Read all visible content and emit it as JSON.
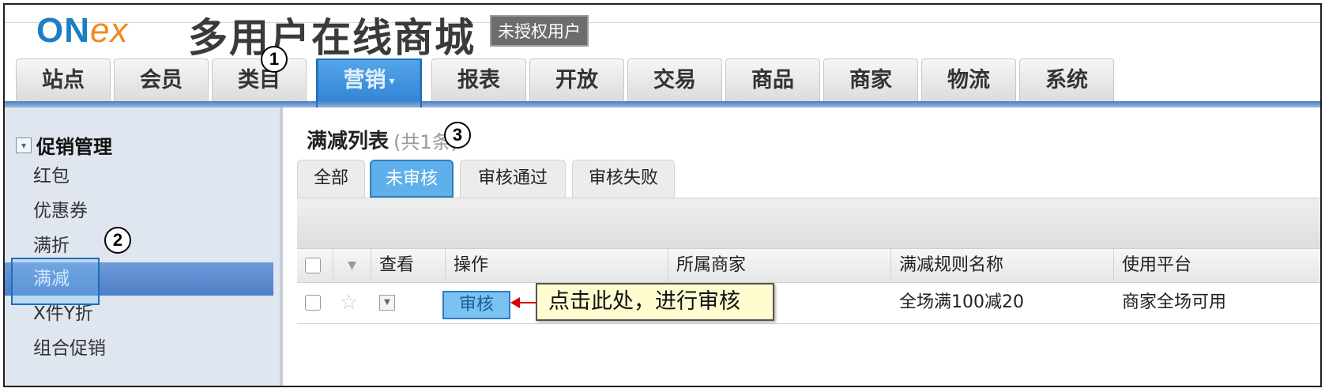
{
  "header": {
    "logo_on": "ON",
    "logo_ex": "ex",
    "title": "多用户在线商城",
    "badge": "未授权用户"
  },
  "nav": {
    "tabs": [
      {
        "label": "站点"
      },
      {
        "label": "会员"
      },
      {
        "label": "类目"
      },
      {
        "label": "营销"
      },
      {
        "label": "报表"
      },
      {
        "label": "开放"
      },
      {
        "label": "交易"
      },
      {
        "label": "商品"
      },
      {
        "label": "商家"
      },
      {
        "label": "物流"
      },
      {
        "label": "系统"
      }
    ],
    "active_index": 3
  },
  "steps": [
    "1",
    "2",
    "3"
  ],
  "sidebar": {
    "group_title": "促销管理",
    "items": [
      {
        "label": "红包"
      },
      {
        "label": "优惠券"
      },
      {
        "label": "满折"
      },
      {
        "label": "满减"
      },
      {
        "label": "X件Y折"
      },
      {
        "label": "组合促销"
      }
    ],
    "active_index": 3
  },
  "main": {
    "title": "满减列表",
    "count": "(共1条)",
    "tabs": [
      {
        "label": "全部"
      },
      {
        "label": "未审核"
      },
      {
        "label": "审核通过"
      },
      {
        "label": "审核失败"
      }
    ],
    "active_tab_index": 1,
    "columns": [
      "查看",
      "操作",
      "所属商家",
      "满减规则名称",
      "使用平台"
    ],
    "rows": [
      {
        "action": "审核",
        "merchant": "",
        "rule_name": "全场满100减20",
        "platform": "商家全场可用"
      }
    ],
    "callout": "点击此处，进行审核"
  },
  "colors": {
    "accent": "#2f7fd4",
    "highlight": "#5fb0ea",
    "callout_bg": "#fffdd0",
    "arrow": "#d80000"
  },
  "icons": [
    "expand-toggle-icon",
    "sort-caret-icon",
    "star-icon",
    "row-dropdown-icon",
    "nav-caret-icon"
  ]
}
